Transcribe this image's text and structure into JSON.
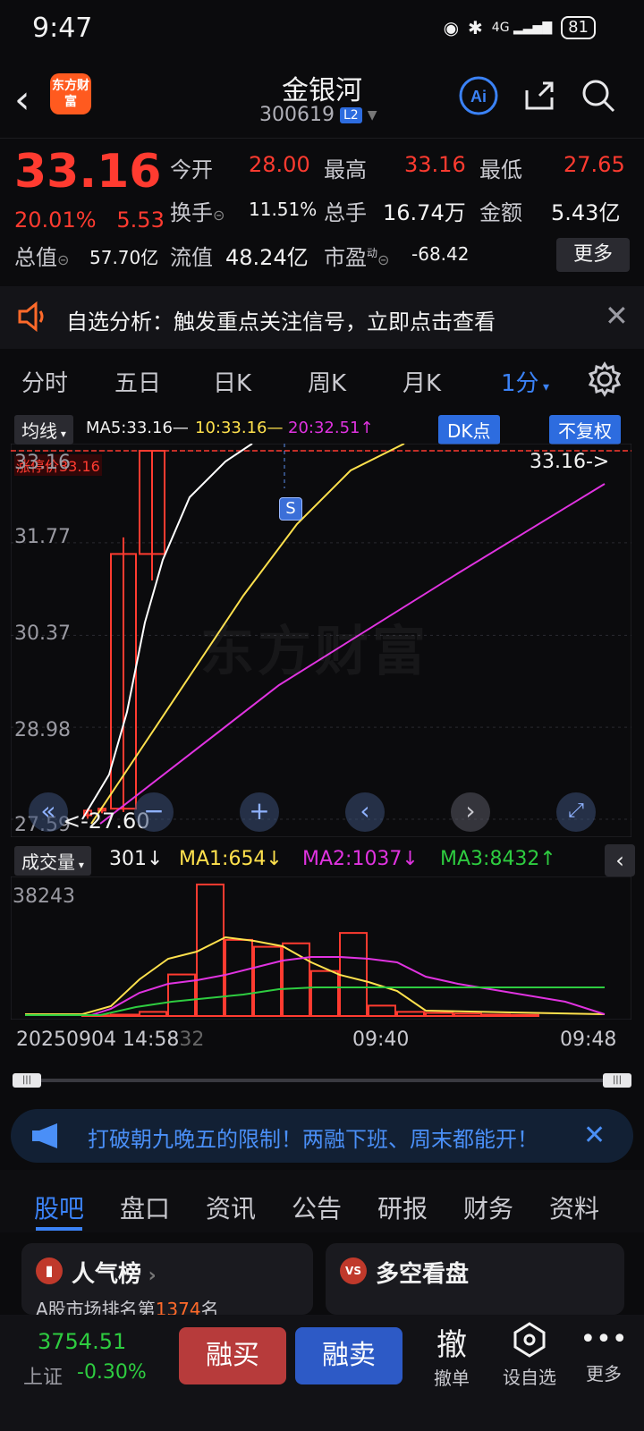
{
  "status": {
    "time": "9:47",
    "battery": "81",
    "net": "4G"
  },
  "header": {
    "logo_text": "东方财富",
    "title": "金银河",
    "code": "300619",
    "badge": "L2"
  },
  "quote": {
    "price": "33.16",
    "pct": "20.01%",
    "chg": "5.53",
    "open_label": "今开",
    "open": "28.00",
    "high_label": "最高",
    "high": "33.16",
    "low_label": "最低",
    "low": "27.65",
    "turnover_label": "换手",
    "turnover": "11.51%",
    "vol_label": "总手",
    "vol": "16.74万",
    "amount_label": "金额",
    "amount": "5.43亿",
    "mktcap_label": "总值",
    "mktcap": "57.70亿",
    "float_label": "流值",
    "float": "48.24亿",
    "pe_label": "市盈",
    "pe_sup": "动",
    "pe": "-68.42",
    "more": "更多"
  },
  "notice": {
    "text": "自选分析：触发重点关注信号，立即点击查看"
  },
  "ktabs": [
    "分时",
    "五日",
    "日K",
    "周K",
    "月K",
    "1分"
  ],
  "mabar": {
    "mode": "均线",
    "ma5": "MA5:33.16—",
    "ma10": "10:33.16—",
    "ma20": "20:32.51↑",
    "dk": "DK点",
    "fq": "不复权"
  },
  "chart": {
    "limit_label": "涨停价33.16",
    "y_labels": [
      "33.16",
      "31.77",
      "30.37",
      "28.98",
      "27.59"
    ],
    "last_label": "33.16->",
    "low_label": "<-27.60",
    "signal": "S",
    "watermark": "东方财富"
  },
  "volhdr": {
    "mode": "成交量",
    "vol": "301↓",
    "ma1": "MA1:654↓",
    "ma2": "MA2:1037↓",
    "ma3": "MA3:8432↑",
    "max": "38243"
  },
  "xaxis": {
    "start": "20250904 14:58",
    "start_tail": "32",
    "mid": "09:40",
    "end": "09:48"
  },
  "banner": {
    "text": "打破朝九晚五的限制！两融下班、周末都能开！"
  },
  "btabs": [
    "股吧",
    "盘口",
    "资讯",
    "公告",
    "研报",
    "财务",
    "资料"
  ],
  "cards": {
    "left_title": "人气榜",
    "left_sub": "A股市场排名第",
    "left_rank": "1374",
    "left_unit": "名",
    "right_title": "多空看盘"
  },
  "bottom": {
    "index_value": "3754.51",
    "index_name": "上证",
    "index_chg": "-0.30%",
    "buy": "融买",
    "sell": "融卖",
    "cancel_glyph": "撤",
    "cancel": "撤单",
    "watch": "设自选",
    "more": "更多"
  },
  "colors": {
    "up": "#ff3b30",
    "down": "#2ecc40",
    "accent": "#3b82f6",
    "ma5": "#ffffff",
    "ma10": "#ffe14d",
    "ma20": "#e033e0",
    "ma3": "#2ecc40"
  },
  "chart_data": [
    {
      "type": "candlestick",
      "y_ticks": [
        33.16,
        31.77,
        30.37,
        28.98,
        27.59
      ],
      "ylim": [
        27.59,
        33.16
      ],
      "candles": [
        {
          "open": 27.65,
          "close": 27.72,
          "high": 27.75,
          "low": 27.6
        },
        {
          "open": 27.72,
          "close": 27.75,
          "high": 27.78,
          "low": 27.68
        },
        {
          "open": 27.75,
          "close": 31.6,
          "high": 31.85,
          "low": 27.7
        },
        {
          "open": 31.6,
          "close": 33.16,
          "high": 33.16,
          "low": 31.2
        }
      ],
      "series": [
        {
          "name": "MA5",
          "end_value": 33.16
        },
        {
          "name": "10",
          "end_value": 33.16
        },
        {
          "name": "20",
          "end_value": 32.51
        }
      ]
    },
    {
      "type": "bar",
      "y_max": 38243,
      "series": [
        {
          "name": "成交量",
          "values": [
            200,
            400,
            1200,
            12000,
            38000,
            22000,
            20000,
            21000,
            13000,
            24000,
            3000,
            1200,
            900,
            700,
            400,
            301
          ]
        },
        {
          "name": "MA1",
          "last": 654
        },
        {
          "name": "MA2",
          "last": 1037
        },
        {
          "name": "MA3",
          "last": 8432
        }
      ]
    }
  ]
}
